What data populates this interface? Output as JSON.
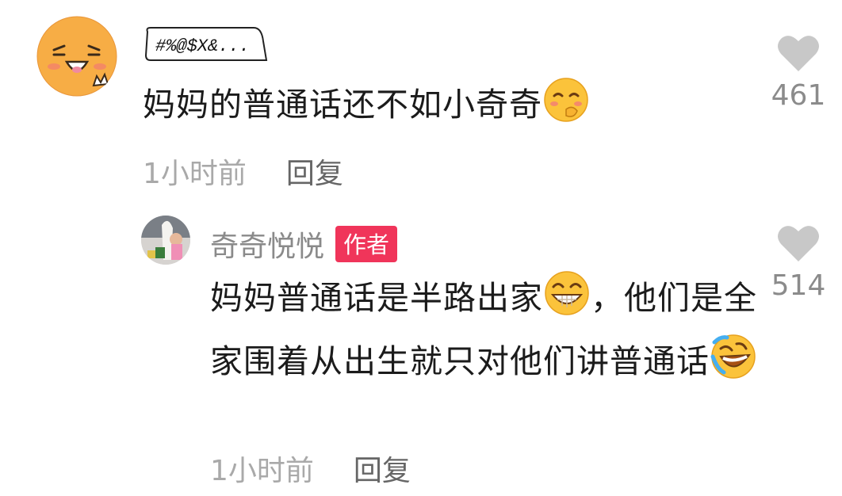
{
  "comment": {
    "username_badge": "#%@$X&...",
    "text": "妈妈的普通话还不如小奇奇",
    "time": "1小时前",
    "reply_label": "回复",
    "likes": "461"
  },
  "reply": {
    "username": "奇奇悦悦",
    "author_badge": "作者",
    "text_a": "妈妈普通话是半路出家",
    "text_b": "，他们是全家围着从出生就只对他们讲普通话",
    "time": "1小时前",
    "reply_label": "回复",
    "likes": "514"
  },
  "colors": {
    "author_badge": "#f0355a",
    "like_icon": "#c8c8c8"
  }
}
